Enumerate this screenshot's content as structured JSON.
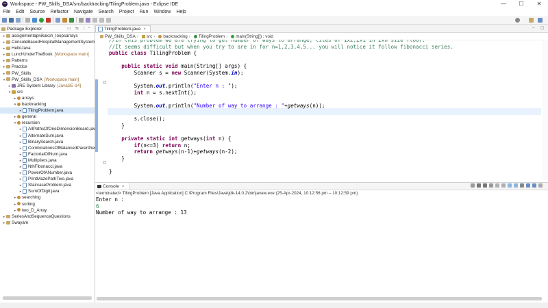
{
  "window": {
    "title": "Workspace - PW_Skills_DSA/src/backtracking/TilingProblem.java - Eclipse IDE",
    "minimize": "—",
    "maximize": "☐",
    "close": "✕"
  },
  "menu": [
    "File",
    "Edit",
    "Source",
    "Refactor",
    "Navigate",
    "Search",
    "Project",
    "Run",
    "Window",
    "Help"
  ],
  "explorer": {
    "title": "Package Explorer",
    "items": [
      {
        "label": "assignmentapnikaksh_loopsarrays",
        "extra": "",
        "indent": 0,
        "twisty": ">",
        "icon": "proj"
      },
      {
        "label": "ConsoleBasedHospitalManagementSystem",
        "extra": "",
        "indent": 0,
        "twisty": ">",
        "icon": "proj"
      },
      {
        "label": "HelloJava",
        "extra": "",
        "indent": 0,
        "twisty": ">",
        "icon": "proj"
      },
      {
        "label": "LunchUnderTheBook",
        "extra": "[Workspace main]",
        "indent": 0,
        "twisty": ">",
        "icon": "proj"
      },
      {
        "label": "Patterns",
        "extra": "",
        "indent": 0,
        "twisty": ">",
        "icon": "proj"
      },
      {
        "label": "Practice",
        "extra": "",
        "indent": 0,
        "twisty": ">",
        "icon": "proj"
      },
      {
        "label": "PW_Skills",
        "extra": "",
        "indent": 0,
        "twisty": ">",
        "icon": "proj"
      },
      {
        "label": "PW_Skills_DSA",
        "extra": "[Workspace main]",
        "indent": 0,
        "twisty": "v",
        "icon": "proj"
      },
      {
        "label": "JRE System Library",
        "extra": "[JavaSE-14]",
        "indent": 1,
        "twisty": ">",
        "icon": "lib"
      },
      {
        "label": "src",
        "extra": "",
        "indent": 1,
        "twisty": "v",
        "icon": "src"
      },
      {
        "label": "arrays",
        "extra": "",
        "indent": 2,
        "twisty": ">",
        "icon": "pkg"
      },
      {
        "label": "backtracking",
        "extra": "",
        "indent": 2,
        "twisty": "v",
        "icon": "pkg"
      },
      {
        "label": "TilingProblem.java",
        "extra": "",
        "indent": 3,
        "twisty": ">",
        "icon": "file",
        "selected": true
      },
      {
        "label": "general",
        "extra": "",
        "indent": 2,
        "twisty": ">",
        "icon": "pkg"
      },
      {
        "label": "recursion",
        "extra": "",
        "indent": 2,
        "twisty": "v",
        "icon": "pkg"
      },
      {
        "label": "AllPathsOfOneDimensionBoard.java",
        "extra": "",
        "indent": 3,
        "twisty": ">",
        "icon": "file"
      },
      {
        "label": "AlternateSum.java",
        "extra": "",
        "indent": 3,
        "twisty": ">",
        "icon": "file"
      },
      {
        "label": "BinarySearch.java",
        "extra": "",
        "indent": 3,
        "twisty": ">",
        "icon": "file"
      },
      {
        "label": "CombinationsOfBalancedParentheses.java",
        "extra": "",
        "indent": 3,
        "twisty": ">",
        "icon": "file"
      },
      {
        "label": "FactorialOfNum.java",
        "extra": "",
        "indent": 3,
        "twisty": ">",
        "icon": "file"
      },
      {
        "label": "Multipliers.java",
        "extra": "",
        "indent": 3,
        "twisty": ">",
        "icon": "file"
      },
      {
        "label": "NthFibonacci.java",
        "extra": "",
        "indent": 3,
        "twisty": ">",
        "icon": "file"
      },
      {
        "label": "PowerOfANumber.java",
        "extra": "",
        "indent": 3,
        "twisty": ">",
        "icon": "file"
      },
      {
        "label": "PrintMazePathTwo.java",
        "extra": "",
        "indent": 3,
        "twisty": ">",
        "icon": "file"
      },
      {
        "label": "StaircaseProblem.java",
        "extra": "",
        "indent": 3,
        "twisty": ">",
        "icon": "file"
      },
      {
        "label": "SumOfDigit.java",
        "extra": "",
        "indent": 3,
        "twisty": ">",
        "icon": "file"
      },
      {
        "label": "searching",
        "extra": "",
        "indent": 2,
        "twisty": ">",
        "icon": "pkg"
      },
      {
        "label": "sorting",
        "extra": "",
        "indent": 2,
        "twisty": ">",
        "icon": "pkg"
      },
      {
        "label": "two_D_Array",
        "extra": "",
        "indent": 2,
        "twisty": ">",
        "icon": "pkg"
      },
      {
        "label": "SeriesAndSequenceQuestions",
        "extra": "",
        "indent": 0,
        "twisty": ">",
        "icon": "proj"
      },
      {
        "label": "Swayam",
        "extra": "",
        "indent": 0,
        "twisty": ">",
        "icon": "proj"
      }
    ]
  },
  "editor": {
    "tab": "TilingProblem.java",
    "breadcrumb": [
      "PW_Skills_DSA",
      "src",
      "backtracking",
      "TilingProblem",
      "main(String[]) : void"
    ],
    "lines": [
      [
        [
          "cm",
          "//In this problem we are trying to get number of ways to arrange, tiles of 1x2,2x1 in 2xn size floor."
        ]
      ],
      [
        [
          "cm",
          "//It seems difficult but when you try to are in for n=1,2,3,4,5... you will notice it follow fibonacci series."
        ]
      ],
      [
        [
          "kw",
          "public class "
        ],
        [
          "",
          "TilingProblem {"
        ]
      ],
      [
        [
          "",
          ""
        ]
      ],
      [
        [
          "",
          "    "
        ],
        [
          "kw",
          "public static void "
        ],
        [
          "",
          "main(String[] args) {"
        ]
      ],
      [
        [
          "",
          "        Scanner s = "
        ],
        [
          "kw",
          "new "
        ],
        [
          "",
          "Scanner(System."
        ],
        [
          "fld",
          "in"
        ],
        [
          "",
          ");"
        ]
      ],
      [
        [
          "",
          ""
        ]
      ],
      [
        [
          "",
          "        System."
        ],
        [
          "fld",
          "out"
        ],
        [
          "",
          ".println("
        ],
        [
          "str",
          "\"Enter n : \""
        ],
        [
          "",
          ");"
        ]
      ],
      [
        [
          "",
          "        "
        ],
        [
          "kw",
          "int "
        ],
        [
          "",
          "n = s.nextInt();"
        ]
      ],
      [
        [
          "",
          ""
        ]
      ],
      [
        [
          "",
          "        System."
        ],
        [
          "fld",
          "out"
        ],
        [
          "",
          ".println("
        ],
        [
          "str",
          "\"Number of way to arrange : \""
        ],
        [
          "",
          "+"
        ],
        [
          "it",
          "getways"
        ],
        [
          "",
          "(n));"
        ]
      ],
      [
        [
          "",
          ""
        ]
      ],
      [
        [
          "",
          "        s.close();"
        ]
      ],
      [
        [
          "",
          "    }"
        ]
      ],
      [
        [
          "",
          ""
        ]
      ],
      [
        [
          "",
          "    "
        ],
        [
          "kw",
          "private static int "
        ],
        [
          "",
          "getways("
        ],
        [
          "kw",
          "int "
        ],
        [
          "",
          "n) {"
        ]
      ],
      [
        [
          "",
          "        "
        ],
        [
          "kw",
          "if"
        ],
        [
          "",
          "(n<=3) "
        ],
        [
          "kw",
          "return "
        ],
        [
          "",
          "n;"
        ]
      ],
      [
        [
          "",
          "        "
        ],
        [
          "kw",
          "return "
        ],
        [
          "it",
          "getways"
        ],
        [
          "",
          "(n-1)+"
        ],
        [
          "it",
          "getways"
        ],
        [
          "",
          "(n-2);"
        ]
      ],
      [
        [
          "",
          "    }"
        ]
      ],
      [
        [
          "",
          ""
        ]
      ],
      [
        [
          "",
          "}"
        ]
      ]
    ]
  },
  "console": {
    "tab": "Console",
    "terminated": "<terminated> TilingProblem [Java Application] C:\\Program Files\\Java\\jdk-14.0.2\\bin\\javaw.exe  (25-Apr-2024, 10:12:56 pm – 10:12:59 pm)",
    "output": [
      {
        "text": "Enter n :",
        "color": "#000000"
      },
      {
        "text": "6",
        "color": "#2e8b57"
      },
      {
        "text": "Number of way to arrange : 13",
        "color": "#000000"
      }
    ]
  },
  "colors": {
    "accent": "#8fb6e0",
    "keyword": "#7f0055",
    "string": "#2a00ff",
    "comment": "#3f7f5f"
  }
}
